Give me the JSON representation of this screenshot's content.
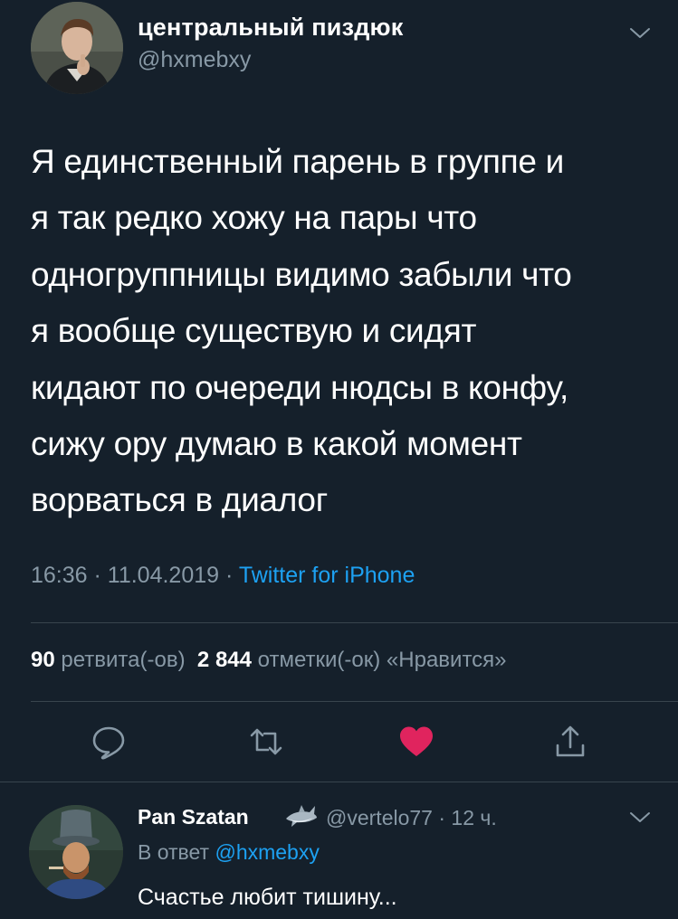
{
  "colors": {
    "background": "#15202b",
    "primary_text": "#ffffff",
    "secondary_text": "#8899a6",
    "accent": "#1da1f2",
    "like": "#e0245e",
    "divider": "#38444d"
  },
  "main_tweet": {
    "author_name": "центральный пиздюк",
    "author_handle": "@hxmebxy",
    "text_lines": [
      "Я единственный парень в группе и",
      "я так редко хожу на пары что",
      "одногруппницы видимо забыли что",
      "я вообще существую и сидят",
      "кидают по очереди нюдсы в конфу,",
      "сижу ору думаю в какой момент",
      "ворваться в диалог"
    ],
    "time": "16:36",
    "separator": " · ",
    "date": "11.04.2019",
    "source": "Twitter for iPhone",
    "retweets_count": "90",
    "retweets_label": "ретвита(-ов)",
    "likes_count": "2 844",
    "likes_label": "отметки(-ок) «Нравится»",
    "liked": true,
    "icons": {
      "reply": "reply-bubble-icon",
      "retweet": "retweet-icon",
      "like": "heart-icon",
      "share": "share-icon",
      "menu": "chevron-down-icon"
    }
  },
  "reply_tweet": {
    "author_name": "Pan Szatan",
    "name_emoji": "shark-icon",
    "author_handle": "@vertelo77",
    "separator": " · ",
    "time_ago": "12 ч.",
    "reply_prefix": "В ответ",
    "reply_mention": "@hxmebxy",
    "text": "Счастье любит тишину..."
  }
}
